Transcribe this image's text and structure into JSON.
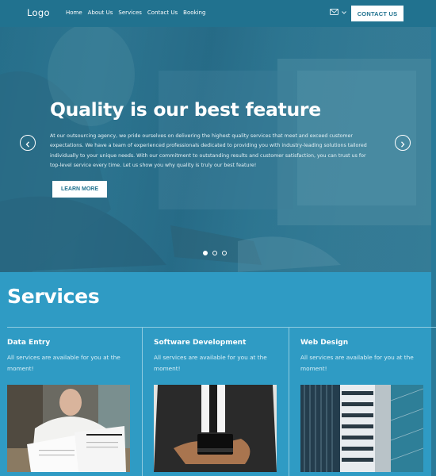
{
  "header": {
    "logo": "Logo",
    "nav": [
      "Home",
      "About Us",
      "Services",
      "Contact Us",
      "Booking"
    ],
    "language_icon": "flag-icon",
    "contact_button": "CONTACT US"
  },
  "hero": {
    "title": "Quality is our best feature",
    "text": "At our outsourcing agency, we pride ourselves on delivering the highest quality services that meet and exceed customer expectations. We have a team of experienced professionals dedicated to providing you with industry-leading solutions tailored individually to your unique needs. With our commitment to outstanding results and customer satisfaction, you can trust us for top-level service every time. Let us show you why quality is truly our best feature!",
    "button": "LEARN MORE",
    "slides_total": 3,
    "active_slide": 1
  },
  "services": {
    "title": "Services",
    "items": [
      {
        "title": "Data Entry",
        "text": "All services are available for you at the moment!",
        "image": "man-holding-documents"
      },
      {
        "title": "Software Development",
        "text": "All services are available for you at the moment!",
        "image": "hands-holding-device"
      },
      {
        "title": "Web Design",
        "text": "All services are available for you at the moment!",
        "image": "office-buildings"
      }
    ]
  },
  "colors": {
    "header_bg": "#21728f",
    "section_bg": "#2f9bc4",
    "button_text": "#21728f"
  }
}
